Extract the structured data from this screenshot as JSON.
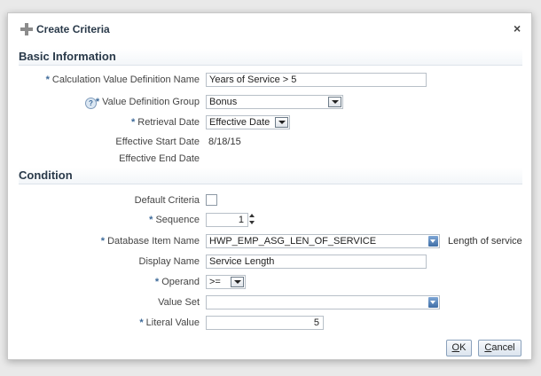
{
  "dialog": {
    "title": "Create Criteria",
    "close": "×"
  },
  "basic": {
    "header": "Basic Information",
    "calc_label": "Calculation Value Definition Name",
    "calc_value": "Years of Service > 5",
    "group_label": "Value Definition Group",
    "group_value": "Bonus",
    "retrieval_label": "Retrieval Date",
    "retrieval_value": "Effective Date",
    "start_label": "Effective Start Date",
    "start_value": "8/18/15",
    "end_label": "Effective End Date"
  },
  "condition": {
    "header": "Condition",
    "default_label": "Default Criteria",
    "default_checked": false,
    "sequence_label": "Sequence",
    "sequence_value": "1",
    "dbitem_label": "Database Item Name",
    "dbitem_value": "HWP_EMP_ASG_LEN_OF_SERVICE",
    "dbitem_desc": "Length of service",
    "display_label": "Display Name",
    "display_value": "Service Length",
    "operand_label": "Operand",
    "operand_value": ">=",
    "valueset_label": "Value Set",
    "valueset_value": "",
    "literal_label": "Literal Value",
    "literal_value": "5"
  },
  "buttons": {
    "ok": "OK",
    "cancel": "Cancel"
  },
  "required_marker": "*",
  "help_marker": "?",
  "colors": {
    "required": "#3d6a99",
    "header_text": "#2a3a4a",
    "button_border": "#8aa1bc"
  }
}
